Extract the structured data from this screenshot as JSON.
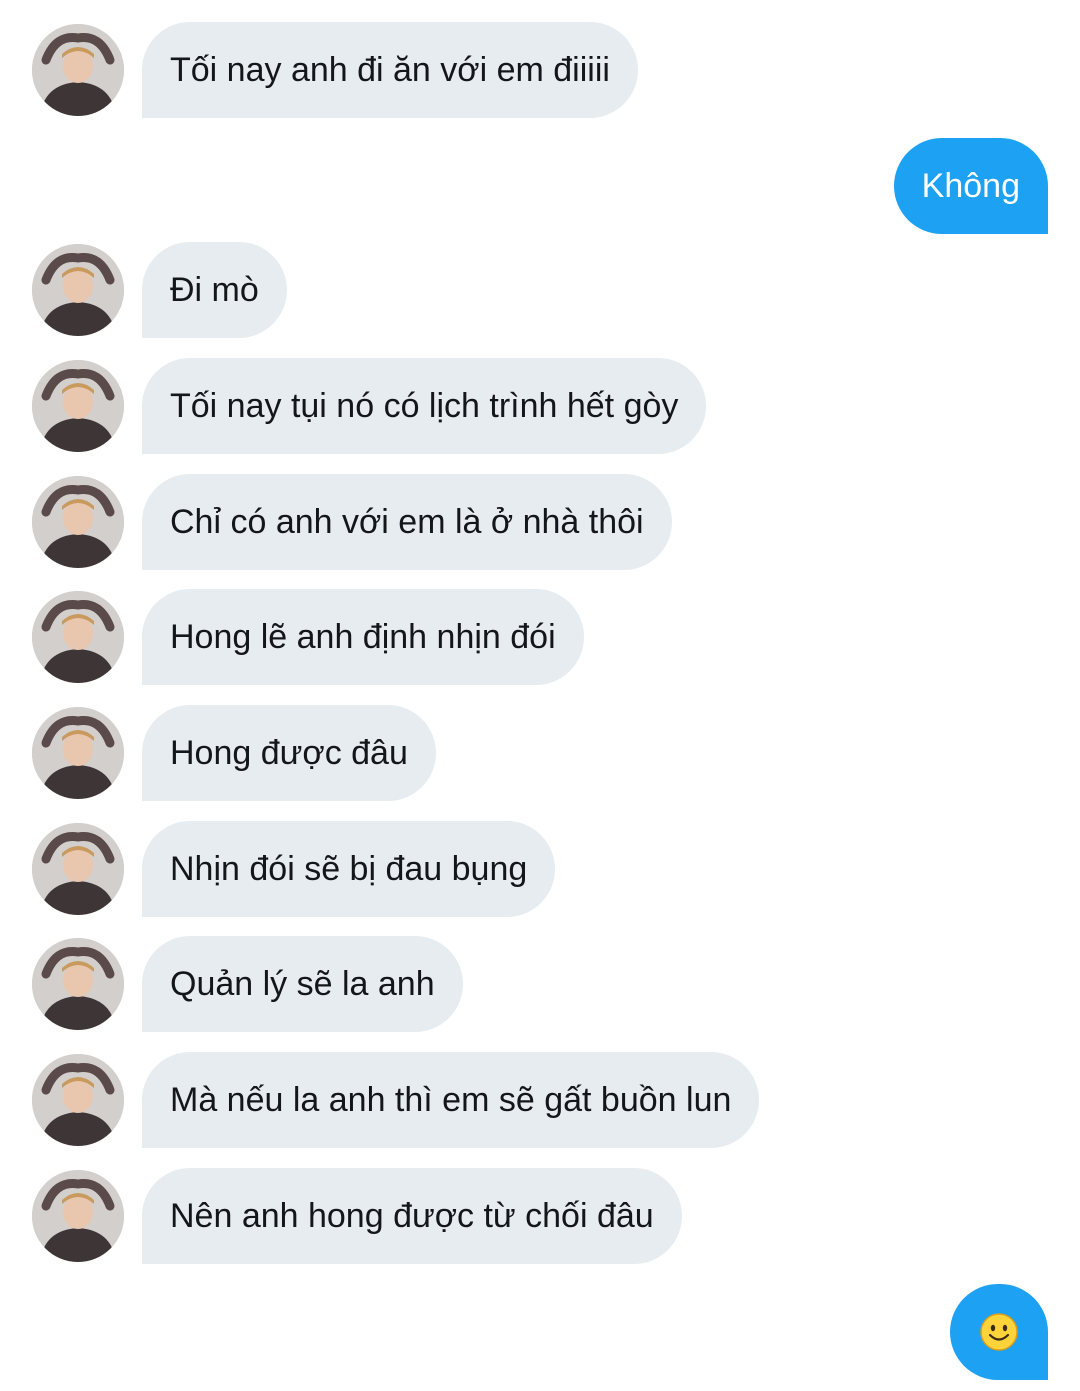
{
  "conversation": {
    "messages": [
      {
        "sender": "other",
        "text": "Tối nay anh đi ăn với em điiiii"
      },
      {
        "sender": "me",
        "text": "Không"
      },
      {
        "sender": "other",
        "text": "Đi mò"
      },
      {
        "sender": "other",
        "text": "Tối nay tụi nó có lịch trình hết gòy"
      },
      {
        "sender": "other",
        "text": "Chỉ có anh với em là ở nhà thôi"
      },
      {
        "sender": "other",
        "text": "Hong lẽ anh định nhịn đói"
      },
      {
        "sender": "other",
        "text": "Hong được đâu"
      },
      {
        "sender": "other",
        "text": "Nhịn đói sẽ bị đau bụng"
      },
      {
        "sender": "other",
        "text": "Quản lý sẽ la anh"
      },
      {
        "sender": "other",
        "text": "Mà nếu la anh thì em sẽ gất buồn lun"
      },
      {
        "sender": "other",
        "text": "Nên anh hong được từ chối đâu"
      },
      {
        "sender": "me",
        "icon": "smiling-face-emoji"
      }
    ]
  },
  "colors": {
    "incoming_bubble": "#e6ecf0",
    "outgoing_bubble": "#1da1f2",
    "incoming_text": "#14171a",
    "outgoing_text": "#ffffff",
    "emoji_face": "#ffd43b"
  }
}
